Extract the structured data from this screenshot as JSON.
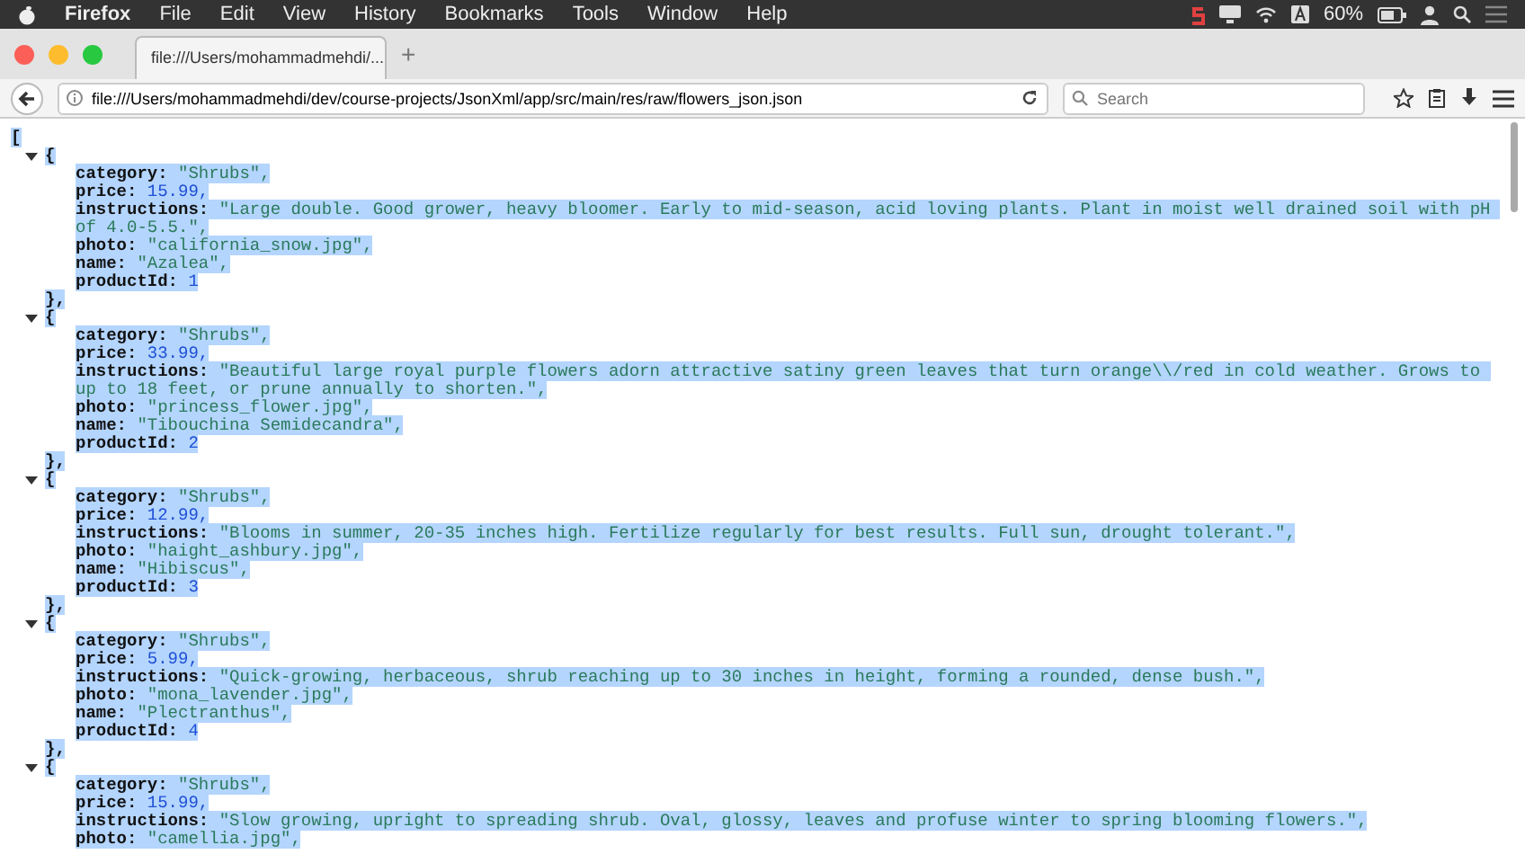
{
  "menubar": {
    "app": "Firefox",
    "menus": [
      "File",
      "Edit",
      "View",
      "History",
      "Bookmarks",
      "Tools",
      "Window",
      "Help"
    ],
    "battery": "60%"
  },
  "tabs": [
    {
      "title": "file:///Users/mohammadmehdi/...",
      "selected": true
    }
  ],
  "new_tab": "+",
  "toolbar": {
    "url": "file:///Users/mohammadmehdi/dev/course-projects/JsonXml/app/src/main/res/raw/flowers_json.json",
    "search": {
      "placeholder": "Search"
    }
  },
  "document": {
    "open": "[",
    "selected": true,
    "records": [
      {
        "open": "{",
        "expanded": true,
        "close": "},",
        "fields": [
          {
            "key": "category:",
            "value": "\"Shrubs\",",
            "kind": "string"
          },
          {
            "key": "price:",
            "value": "15.99,",
            "kind": "number"
          },
          {
            "key": "instructions:",
            "value": "\"Large double. Good grower, heavy bloomer. Early to mid-season, acid loving plants. Plant in moist well drained soil with pH of 4.0-5.5.\",",
            "kind": "string"
          },
          {
            "key": "photo:",
            "value": "\"california_snow.jpg\",",
            "kind": "string"
          },
          {
            "key": "name:",
            "value": "\"Azalea\",",
            "kind": "string"
          },
          {
            "key": "productId:",
            "value": "1",
            "kind": "number"
          }
        ]
      },
      {
        "open": "{",
        "expanded": true,
        "close": "},",
        "fields": [
          {
            "key": "category:",
            "value": "\"Shrubs\",",
            "kind": "string"
          },
          {
            "key": "price:",
            "value": "33.99,",
            "kind": "number"
          },
          {
            "key": "instructions:",
            "value": "\"Beautiful large royal purple flowers adorn attractive satiny green leaves that turn orange\\\\/red in cold weather. Grows to up to 18 feet, or prune annually to shorten.\",",
            "kind": "string"
          },
          {
            "key": "photo:",
            "value": "\"princess_flower.jpg\",",
            "kind": "string"
          },
          {
            "key": "name:",
            "value": "\"Tibouchina Semidecandra\",",
            "kind": "string"
          },
          {
            "key": "productId:",
            "value": "2",
            "kind": "number"
          }
        ]
      },
      {
        "open": "{",
        "expanded": true,
        "close": "},",
        "fields": [
          {
            "key": "category:",
            "value": "\"Shrubs\",",
            "kind": "string"
          },
          {
            "key": "price:",
            "value": "12.99,",
            "kind": "number"
          },
          {
            "key": "instructions:",
            "value": "\"Blooms in summer, 20-35 inches high. Fertilize regularly for best results. Full sun, drought tolerant.\",",
            "kind": "string"
          },
          {
            "key": "photo:",
            "value": "\"haight_ashbury.jpg\",",
            "kind": "string"
          },
          {
            "key": "name:",
            "value": "\"Hibiscus\",",
            "kind": "string"
          },
          {
            "key": "productId:",
            "value": "3",
            "kind": "number"
          }
        ]
      },
      {
        "open": "{",
        "expanded": true,
        "close": "},",
        "fields": [
          {
            "key": "category:",
            "value": "\"Shrubs\",",
            "kind": "string"
          },
          {
            "key": "price:",
            "value": "5.99,",
            "kind": "number"
          },
          {
            "key": "instructions:",
            "value": "\"Quick-growing, herbaceous, shrub reaching up to 30 inches in height, forming a rounded, dense bush.\",",
            "kind": "string"
          },
          {
            "key": "photo:",
            "value": "\"mona_lavender.jpg\",",
            "kind": "string"
          },
          {
            "key": "name:",
            "value": "\"Plectranthus\",",
            "kind": "string"
          },
          {
            "key": "productId:",
            "value": "4",
            "kind": "number"
          }
        ]
      },
      {
        "open": "{",
        "expanded": true,
        "fields": [
          {
            "key": "category:",
            "value": "\"Shrubs\",",
            "kind": "string"
          },
          {
            "key": "price:",
            "value": "15.99,",
            "kind": "number"
          },
          {
            "key": "instructions:",
            "value": "\"Slow growing, upright to spreading shrub. Oval, glossy, leaves and profuse winter to spring blooming flowers.\",",
            "kind": "string"
          },
          {
            "key": "photo:",
            "value": "\"camellia.jpg\",",
            "kind": "string"
          }
        ]
      }
    ]
  }
}
